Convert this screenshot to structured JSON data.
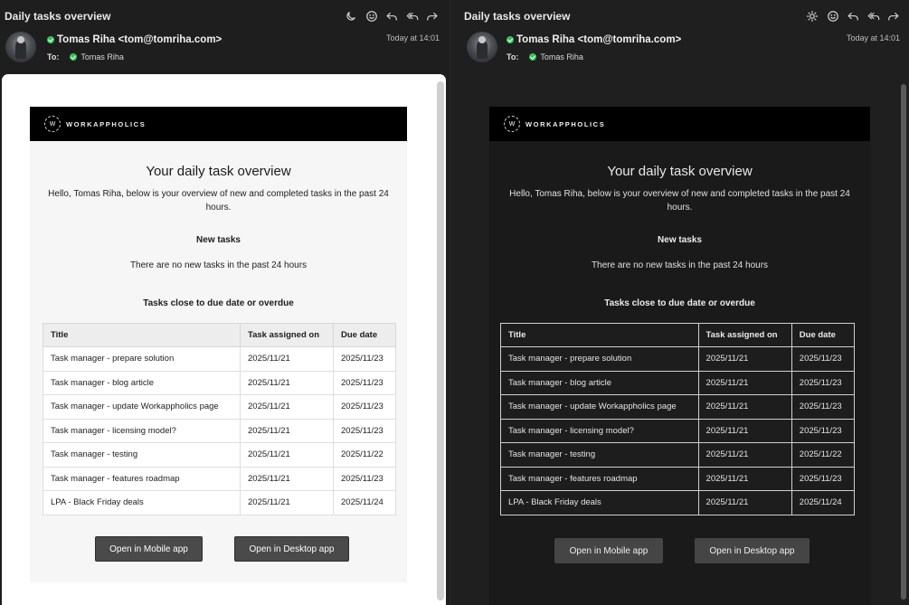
{
  "panes": [
    {
      "subject": "Daily tasks overview",
      "sender": "Tomas Riha <tom@tomriha.com>",
      "to_label": "To:",
      "to_name": "Tomas Riha",
      "time": "Today at 14:01",
      "toolbar_icons": [
        "moon-icon",
        "smiley-icon",
        "reply-icon",
        "reply-all-icon",
        "forward-icon"
      ]
    },
    {
      "subject": "Daily tasks overview",
      "sender": "Tomas Riha <tom@tomriha.com>",
      "to_label": "To:",
      "to_name": "Tomas Riha",
      "time": "Today at 14:01",
      "toolbar_icons": [
        "sun-icon",
        "smiley-icon",
        "reply-icon",
        "reply-all-icon",
        "forward-icon"
      ]
    }
  ],
  "email": {
    "brand": "WORKAPPHOLICS",
    "logo_letter": "W",
    "headline": "Your daily task overview",
    "intro": "Hello, Tomas Riha, below is your overview of new and completed tasks in the past 24 hours.",
    "new_tasks_title": "New tasks",
    "no_new_tasks": "There are no new tasks in the past 24 hours",
    "due_title": "Tasks close to due date or overdue",
    "columns": [
      "Title",
      "Task assigned on",
      "Due date"
    ],
    "rows": [
      [
        "Task manager - prepare solution",
        "2025/11/21",
        "2025/11/23"
      ],
      [
        "Task manager - blog article",
        "2025/11/21",
        "2025/11/23"
      ],
      [
        "Task manager - update Workappholics page",
        "2025/11/21",
        "2025/11/23"
      ],
      [
        "Task manager - licensing model?",
        "2025/11/21",
        "2025/11/23"
      ],
      [
        "Task manager - testing",
        "2025/11/21",
        "2025/11/22"
      ],
      [
        "Task manager - features roadmap",
        "2025/11/21",
        "2025/11/23"
      ],
      [
        "LPA - Black Friday deals",
        "2025/11/21",
        "2025/11/24"
      ]
    ],
    "btn_mobile": "Open in Mobile app",
    "btn_desktop": "Open in Desktop app"
  }
}
